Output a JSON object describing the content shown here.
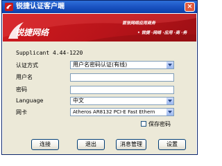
{
  "window": {
    "title": "锐捷认证客户端",
    "close_glyph": "×"
  },
  "banner": {
    "logo_text": "锐捷网络",
    "slogan_line1": "首张网络应用商务",
    "slogan_line2": "• 锐捷 ·网络 ·应用 ·商 ·务"
  },
  "form": {
    "version": "Supplicant 4.44-1220",
    "auth_mode": {
      "label": "认证方式",
      "value": "用户名密码认证(有线)"
    },
    "username": {
      "label": "用户名",
      "value": ""
    },
    "password": {
      "label": "密码",
      "value": ""
    },
    "language": {
      "label": "Language",
      "value": "中文"
    },
    "nic": {
      "label": "网卡",
      "value": "Atheros AR8132 PCI-E Fast Ethern"
    },
    "save_password": {
      "label": "保存密码",
      "checked": false
    }
  },
  "buttons": {
    "connect": "连接",
    "exit": "退出",
    "message_manage": "消息管理",
    "settings": "设置"
  },
  "colors": {
    "titlebar": "#1c55c4",
    "banner": "#c8181c",
    "dialog_bg": "#ece9d8",
    "field_border": "#7f9db9"
  }
}
